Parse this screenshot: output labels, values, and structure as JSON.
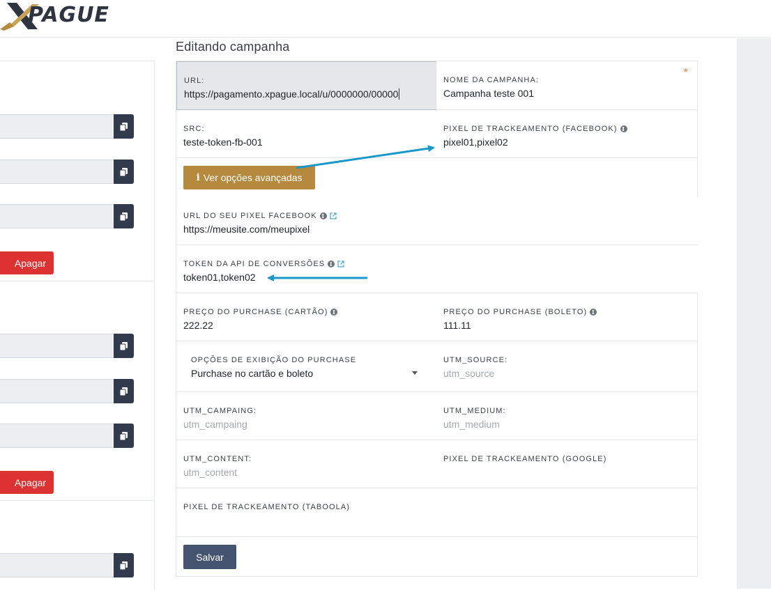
{
  "brand": {
    "logo_text": "PAGUE",
    "accent": "#b58a3e"
  },
  "page": {
    "title": "Editando campanha"
  },
  "left_panel": {
    "delete_label": "Apagar"
  },
  "form": {
    "url": {
      "label": "URL:",
      "value": "https://pagamento.xpague.local/u/0000000/00000"
    },
    "campaign_name": {
      "label": "NOME DA CAMPANHA:",
      "value": "Campanha teste 001",
      "required_mark": "*"
    },
    "src": {
      "label": "SRC:",
      "value": "teste-token-fb-001"
    },
    "pixel_facebook": {
      "label": "PIXEL DE TRACKEAMENTO (FACEBOOK)",
      "value": "pixel01,pixel02"
    },
    "advanced_button": {
      "icon": "i",
      "label": "Ver opções avançadas"
    },
    "pixel_url_facebook": {
      "label": "URL DO SEU PIXEL FACEBOOK",
      "value": "https://meusite.com/meupixel"
    },
    "conversion_token": {
      "label": "TOKEN DA API DE CONVERSÕES",
      "value": "token01,token02"
    },
    "purchase_price_card": {
      "label": "PREÇO DO PURCHASE (CARTÃO)",
      "value": "222.22"
    },
    "purchase_price_boleto": {
      "label": "PREÇO DO PURCHASE (BOLETO)",
      "value": "111.11"
    },
    "purchase_display": {
      "label": "OPÇÕES DE EXIBIÇÃO DO PURCHASE",
      "value": "Purchase no cartão e boleto"
    },
    "utm_source": {
      "label": "UTM_SOURCE:",
      "placeholder": "utm_source"
    },
    "utm_campaing": {
      "label": "UTM_CAMPAING:",
      "placeholder": "utm_campaing"
    },
    "utm_medium": {
      "label": "UTM_MEDIUM:",
      "placeholder": "utm_medium"
    },
    "utm_content": {
      "label": "UTM_CONTENT:",
      "placeholder": "utm_content"
    },
    "pixel_google": {
      "label": "PIXEL DE TRACKEAMENTO (GOOGLE)",
      "value": ""
    },
    "pixel_taboola": {
      "label": "PIXEL DE TRACKEAMENTO (TABOOLA)",
      "value": ""
    },
    "save_label": "Salvar"
  },
  "colors": {
    "copy_button": "#323a4d",
    "delete_button": "#dc3232",
    "save_button": "#445470",
    "annotation_arrow": "#1b97c9"
  }
}
